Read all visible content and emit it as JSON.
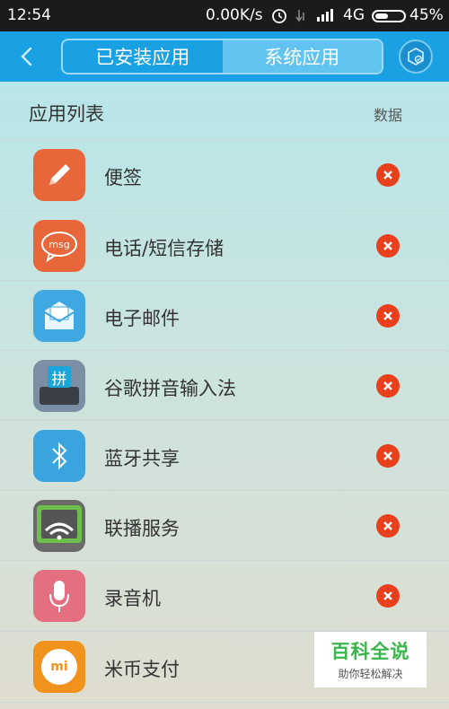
{
  "status_bar": {
    "time": "12:54",
    "speed": "0.00K/s",
    "network": "4G",
    "battery": "45%",
    "battery_level": 0.45
  },
  "header": {
    "tabs": [
      {
        "label": "已安装应用",
        "active": false
      },
      {
        "label": "系统应用",
        "active": true
      }
    ]
  },
  "list": {
    "title": "应用列表",
    "data_label": "数据",
    "items": [
      {
        "name": "便签",
        "icon": "pencil-icon",
        "color": "#e8673a"
      },
      {
        "name": "电话/短信存储",
        "icon": "msg-icon",
        "color": "#e8673a"
      },
      {
        "name": "电子邮件",
        "icon": "mail-icon",
        "color": "#3fa8e0"
      },
      {
        "name": "谷歌拼音输入法",
        "icon": "keyboard-icon",
        "icon_text": "拼",
        "color": "#7b8ea3"
      },
      {
        "name": "蓝牙共享",
        "icon": "bluetooth-icon",
        "color": "#3aa4de"
      },
      {
        "name": "联播服务",
        "icon": "cast-icon",
        "color": "#6a6a6a"
      },
      {
        "name": "录音机",
        "icon": "mic-icon",
        "color": "#e36f81"
      },
      {
        "name": "米币支付",
        "icon": "mi-coin-icon",
        "icon_text": "mi",
        "color": "#f0921b"
      }
    ]
  },
  "watermark": {
    "line1": "百科全说",
    "line2": "助你轻松解决"
  }
}
